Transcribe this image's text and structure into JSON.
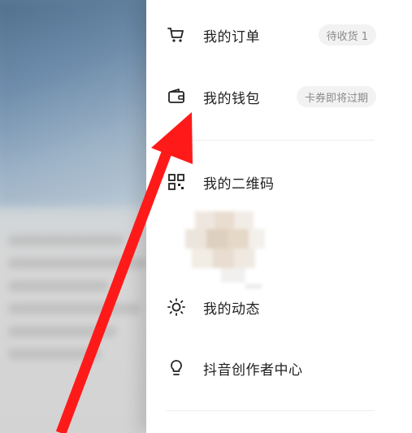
{
  "menu": {
    "items": [
      {
        "label": "我的订单",
        "icon": "cart-icon",
        "badge": "待收货 1"
      },
      {
        "label": "我的钱包",
        "icon": "wallet-icon",
        "badge": "卡券即将过期"
      },
      {
        "label": "我的二维码",
        "icon": "qrcode-icon"
      },
      {
        "label": "我的动态",
        "icon": "sun-icon"
      },
      {
        "label": "抖音创作者中心",
        "icon": "bulb-icon"
      }
    ]
  },
  "annotation": {
    "arrow_color": "#ff1a1a"
  }
}
